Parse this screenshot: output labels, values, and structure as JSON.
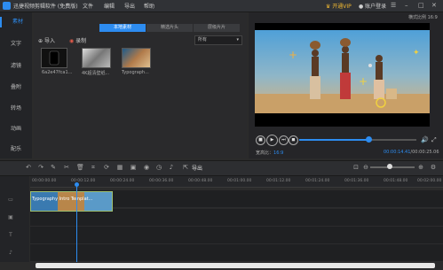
{
  "titlebar": {
    "app_title": "迅捷视频剪辑软件 (免费版)",
    "menus": [
      "文件",
      "编辑",
      "导出",
      "帮助"
    ],
    "vip": "开通VIP",
    "login": "账户登录"
  },
  "sidebar": {
    "items": [
      {
        "label": "素材"
      },
      {
        "label": "文字"
      },
      {
        "label": "滤镜"
      },
      {
        "label": "叠附"
      },
      {
        "label": "转场"
      },
      {
        "label": "动画"
      },
      {
        "label": "配乐"
      }
    ]
  },
  "media": {
    "tabs": [
      {
        "label": "本地素材"
      },
      {
        "label": "精选片头"
      },
      {
        "label": "层级片片"
      }
    ],
    "import_label": "导入",
    "record_label": "录制",
    "filter_value": "所有",
    "thumbs": [
      {
        "label": "6a2e47fca1..."
      },
      {
        "label": "4K超清壁纸..."
      },
      {
        "label": "Typograph..."
      }
    ]
  },
  "preview": {
    "aspect_label": "横式比例 16:9",
    "ratio_text": "宽高比：",
    "ratio_value": "16:9",
    "time_current": "00:00:14.41",
    "time_total": "00:00:25.06",
    "progress": 0.59
  },
  "toolbar": {
    "export_label": "导出"
  },
  "timeline": {
    "ticks": [
      "00:00:00.00",
      "00:00:12.00",
      "00:00:24.00",
      "00:00:36.00",
      "00:00:48.00",
      "00:01:00.00",
      "00:01:12.00",
      "00:01:24.00",
      "00:01:36.00",
      "00:01:48.00",
      "00:02:00.00"
    ],
    "clip_label": "Typography Intro Templat..."
  },
  "colors": {
    "accent": "#2d8cf0",
    "vip": "#f0b832",
    "clip_border": "#9fc070"
  }
}
